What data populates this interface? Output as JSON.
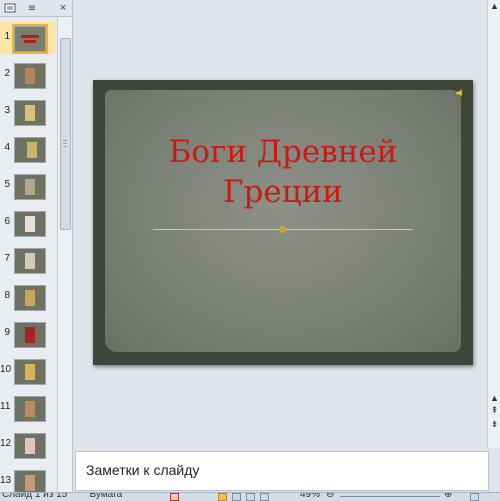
{
  "slides_panel": {
    "tabs": [
      {
        "name": "slides-tab-icon"
      },
      {
        "name": "outline-tab-icon",
        "glyph": "≡"
      }
    ],
    "close_glyph": "×",
    "thumbnails": [
      {
        "number": "1",
        "selected": true
      },
      {
        "number": "2"
      },
      {
        "number": "3"
      },
      {
        "number": "4"
      },
      {
        "number": "5"
      },
      {
        "number": "6"
      },
      {
        "number": "7"
      },
      {
        "number": "8"
      },
      {
        "number": "9"
      },
      {
        "number": "10"
      },
      {
        "number": "11"
      },
      {
        "number": "12"
      },
      {
        "number": "13"
      }
    ]
  },
  "slide": {
    "title_line1": "Боги Древней",
    "title_line2": "Греции",
    "title_color": "#cc1a13"
  },
  "notes": {
    "placeholder": "Заметки к слайду"
  },
  "status_bar": {
    "slide_info": "Слайд 1 из 15",
    "theme": "\"Бумага\"",
    "zoom": "49%"
  }
}
